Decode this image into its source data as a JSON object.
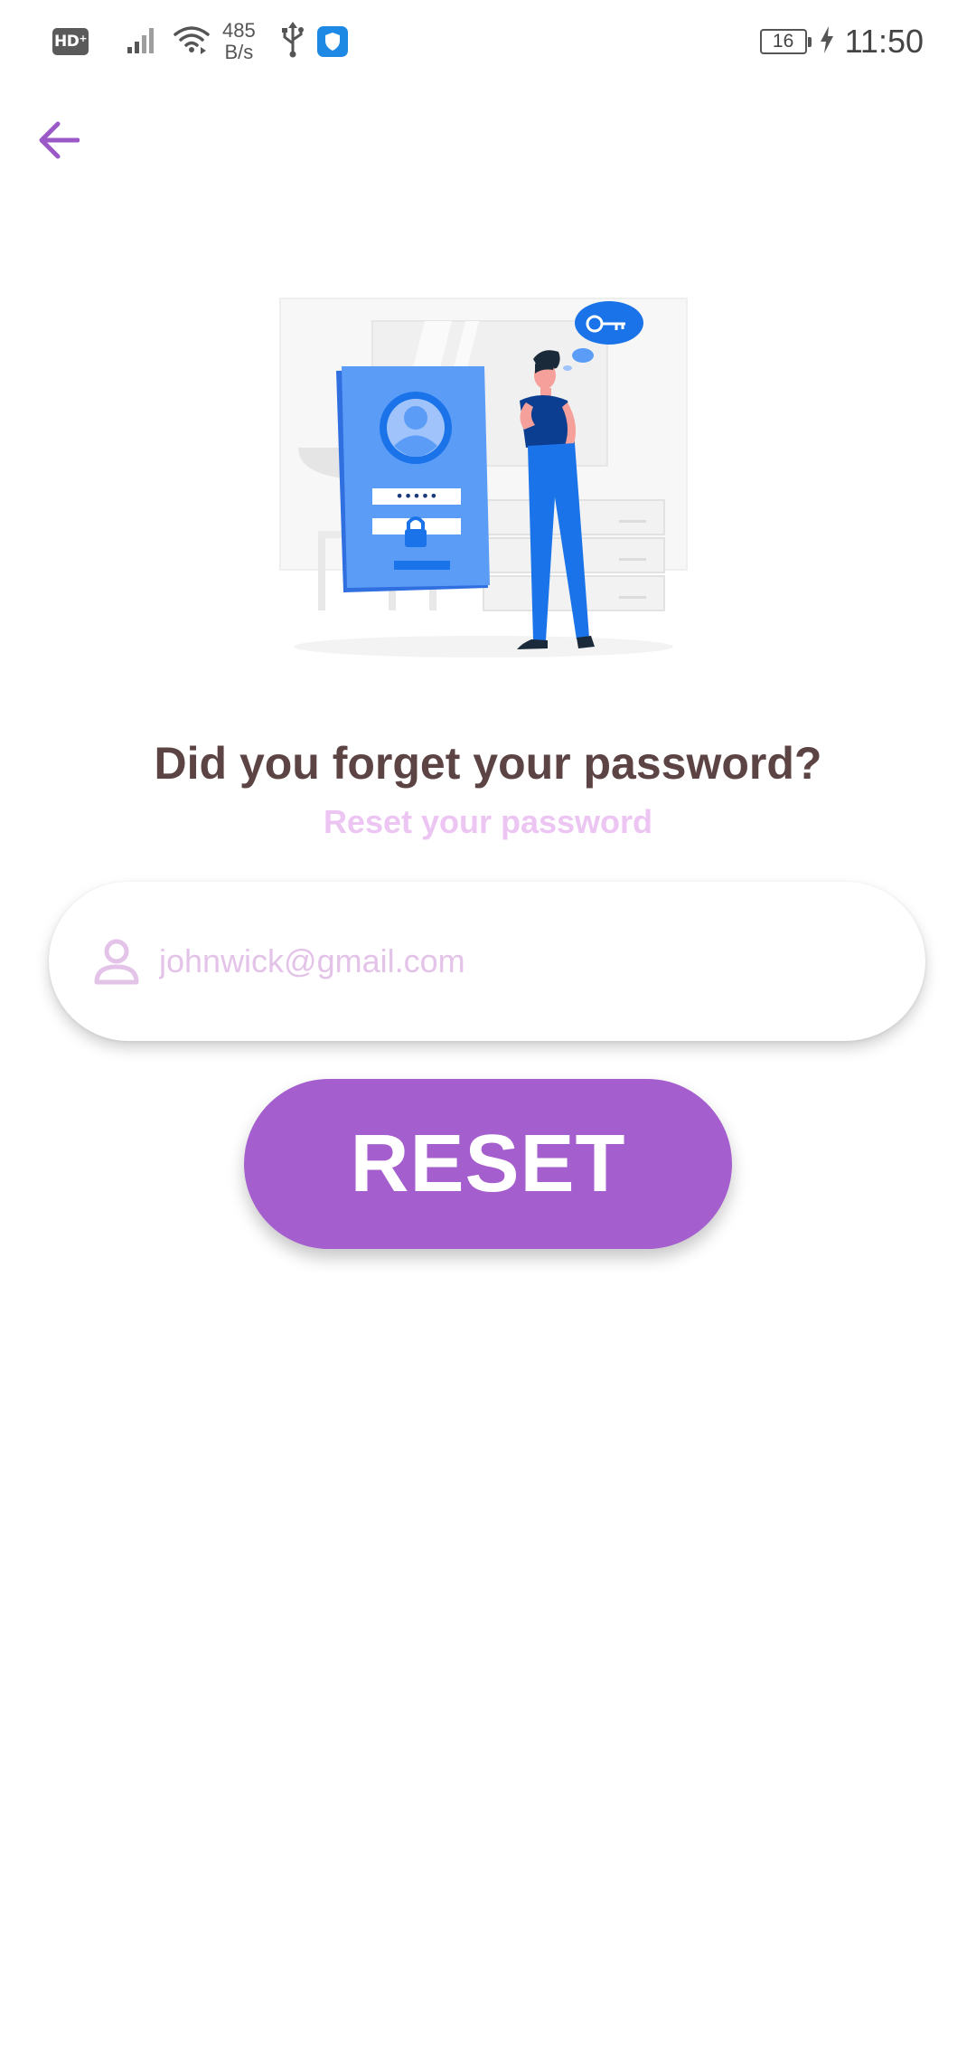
{
  "status_bar": {
    "hd_label": "HD",
    "net_speed_value": "485",
    "net_speed_unit": "B/s",
    "battery_level": "16",
    "time": "11:50",
    "icons": [
      "hd-icon",
      "signal-icon",
      "wifi-icon",
      "usb-icon",
      "shield-icon",
      "battery-icon",
      "charging-icon"
    ]
  },
  "nav": {
    "back_icon": "arrow-left-icon"
  },
  "illustration": {
    "icon": "forgot-password-illustration",
    "password_mask": "•••••"
  },
  "content": {
    "title": "Did you forget your password?",
    "subtitle": "Reset your password"
  },
  "form": {
    "email_placeholder": "johnwick@gmail.com",
    "email_value": "",
    "email_icon": "person-icon",
    "reset_label": "RESET"
  },
  "colors": {
    "accent": "#a55ecd",
    "title": "#5d4444",
    "subtitle": "#ecc5f3",
    "placeholder": "#e4c3e9",
    "illustration_blue": "#4a90f5"
  }
}
